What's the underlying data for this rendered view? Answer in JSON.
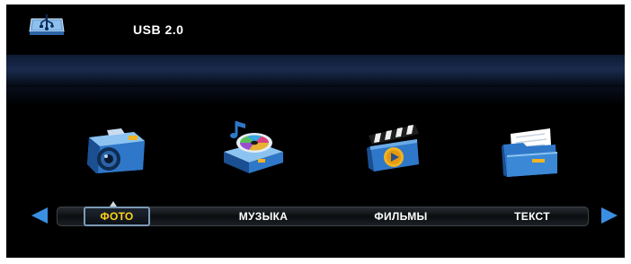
{
  "header": {
    "device_label": "USB 2.0",
    "device_icon": "usb-drive-icon"
  },
  "media_icons": [
    {
      "name": "camera-icon",
      "colors": {
        "body": "#2f78c9",
        "lens": "#1a3d6e"
      }
    },
    {
      "name": "music-projector-icon",
      "colors": {
        "body": "#2f78c9",
        "disc": "#e7b233"
      }
    },
    {
      "name": "clapperboard-icon",
      "colors": {
        "body": "#2f78c9",
        "play": "#f0b323"
      }
    },
    {
      "name": "document-folder-icon",
      "colors": {
        "body": "#2f78c9",
        "paper": "#ffffff"
      }
    }
  ],
  "menu": {
    "items": [
      {
        "label": "ФОТО",
        "selected": true
      },
      {
        "label": "МУЗЫКА",
        "selected": false
      },
      {
        "label": "ФИЛЬМЫ",
        "selected": false
      },
      {
        "label": "ТЕКСТ",
        "selected": false
      }
    ],
    "left_arrow": "arrow-left-icon",
    "right_arrow": "arrow-right-icon"
  },
  "colors": {
    "background": "#000000",
    "accent": "#3b8fe0",
    "selected_text": "#ffd31a",
    "text": "#ffffff"
  }
}
